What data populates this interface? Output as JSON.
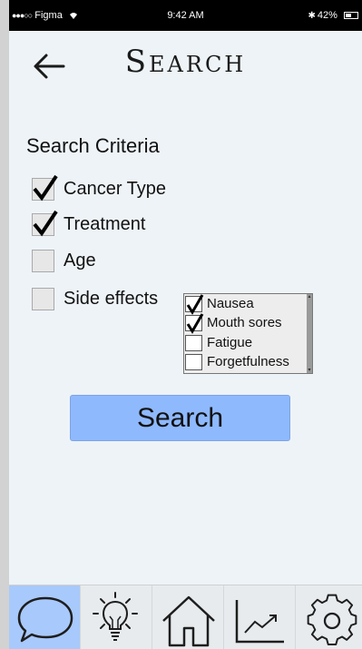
{
  "status_bar": {
    "carrier": "Figma",
    "time": "9:42 AM",
    "battery": "42%"
  },
  "header": {
    "title": "Search",
    "back_icon": "back-arrow-icon"
  },
  "criteria": {
    "title": "Search Criteria",
    "items": [
      {
        "label": "Cancer Type",
        "checked": true
      },
      {
        "label": "Treatment",
        "checked": true
      },
      {
        "label": "Age",
        "checked": false
      },
      {
        "label": "Side effects",
        "checked": false
      }
    ]
  },
  "side_effects": {
    "options": [
      {
        "label": "Nausea",
        "checked": true
      },
      {
        "label": "Mouth sores",
        "checked": true
      },
      {
        "label": "Fatigue",
        "checked": false
      },
      {
        "label": "Forgetfulness",
        "checked": false
      }
    ]
  },
  "search_button": {
    "label": "Search"
  },
  "tab_bar": {
    "tabs": [
      {
        "icon": "chat-bubble-icon",
        "active": true
      },
      {
        "icon": "lightbulb-icon",
        "active": false
      },
      {
        "icon": "home-icon",
        "active": false
      },
      {
        "icon": "trend-chart-icon",
        "active": false
      },
      {
        "icon": "gear-icon",
        "active": false
      }
    ]
  },
  "colors": {
    "accent": "#8eb9fd",
    "active_tab": "#a8c9fb",
    "background": "#eef3f7"
  }
}
